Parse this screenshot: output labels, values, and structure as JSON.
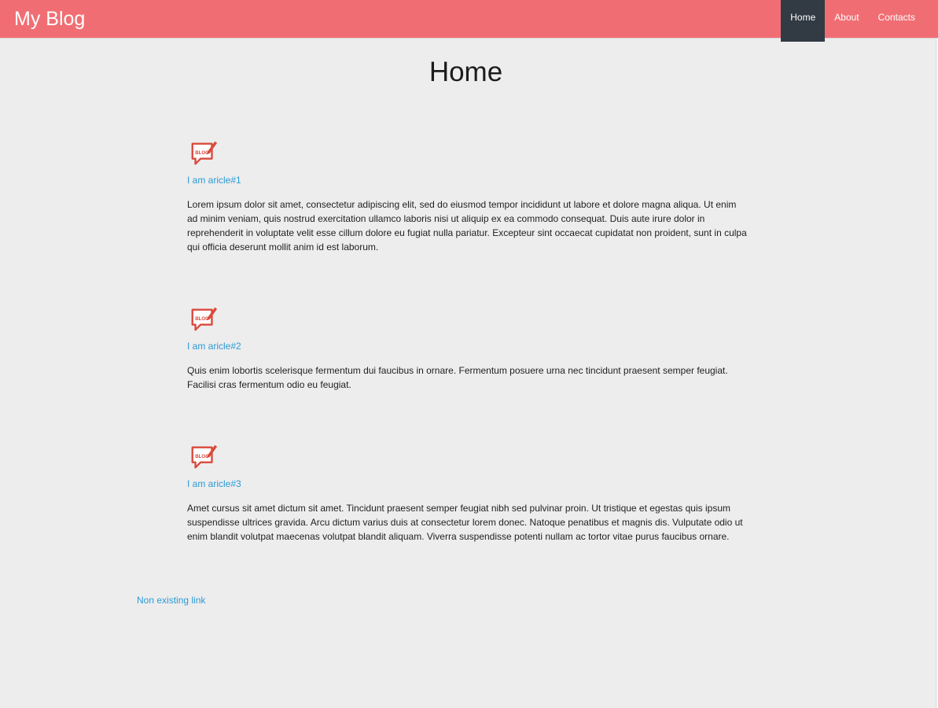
{
  "header": {
    "brand": "My Blog",
    "nav": [
      {
        "label": "Home",
        "active": true
      },
      {
        "label": "About",
        "active": false
      },
      {
        "label": "Contacts",
        "active": false
      }
    ]
  },
  "main": {
    "title": "Home",
    "articles": [
      {
        "icon": "blog-icon",
        "title": "I am aricle#1",
        "body": "Lorem ipsum dolor sit amet, consectetur adipiscing elit, sed do eiusmod tempor incididunt ut labore et dolore magna aliqua. Ut enim ad minim veniam, quis nostrud exercitation ullamco laboris nisi ut aliquip ex ea commodo consequat. Duis aute irure dolor in reprehenderit in voluptate velit esse cillum dolore eu fugiat nulla pariatur. Excepteur sint occaecat cupidatat non proident, sunt in culpa qui officia deserunt mollit anim id est laborum."
      },
      {
        "icon": "blog-icon",
        "title": "I am aricle#2",
        "body": "Quis enim lobortis scelerisque fermentum dui faucibus in ornare. Fermentum posuere urna nec tincidunt praesent semper feugiat. Facilisi cras fermentum odio eu feugiat."
      },
      {
        "icon": "blog-icon",
        "title": "I am aricle#3",
        "body": "Amet cursus sit amet dictum sit amet. Tincidunt praesent semper feugiat nibh sed pulvinar proin. Ut tristique et egestas quis ipsum suspendisse ultrices gravida. Arcu dictum varius duis at consectetur lorem donec. Natoque penatibus et magnis dis. Vulputate odio ut enim blandit volutpat maecenas volutpat blandit aliquam. Viverra suspendisse potenti nullam ac tortor vitae purus faucibus ornare."
      }
    ],
    "extra_link": "Non existing link"
  },
  "colors": {
    "header_bg": "#f06e73",
    "active_nav_bg": "#323a44",
    "link": "#2b9ad6",
    "page_bg": "#ededed",
    "icon": "#d94a3d"
  }
}
